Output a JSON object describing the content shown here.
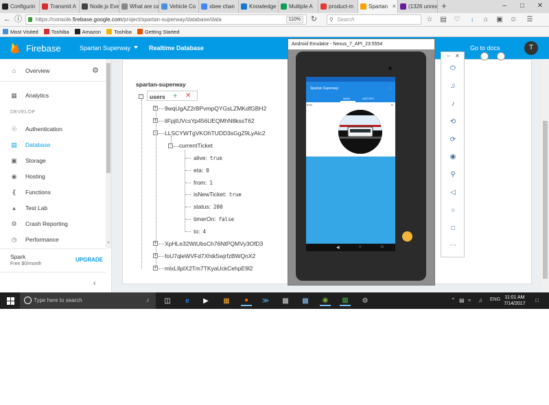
{
  "browser": {
    "tabs": [
      {
        "label": "Configurin",
        "color": "#222222"
      },
      {
        "label": "Transmit A",
        "color": "#d32f2f"
      },
      {
        "label": "Node.js Eve",
        "color": "#444444"
      },
      {
        "label": "What are callb",
        "color": "#888888"
      },
      {
        "label": "Vehicle Co",
        "color": "#4a90d9"
      },
      {
        "label": "xbee chan",
        "color": "#4285f4"
      },
      {
        "label": "Knowledge",
        "color": "#1976d2"
      },
      {
        "label": "Multiple A",
        "color": "#0f9d58"
      },
      {
        "label": "product-m",
        "color": "#e53935"
      },
      {
        "label": "Spartan",
        "color": "#ffa000"
      },
      {
        "label": "(1326 unrea",
        "color": "#6a1b9a"
      }
    ],
    "url_prefix": "https://console.",
    "url_domain": "firebase.google.com",
    "url_rest": "/project/spartan-superway/database/data",
    "zoom": "110%",
    "search_placeholder": "Search",
    "bookmarks": [
      {
        "label": "Most Visited",
        "color": "#4a90d9"
      },
      {
        "label": "Toshiba",
        "color": "#d32f2f"
      },
      {
        "label": "Amazon",
        "color": "#222222"
      },
      {
        "label": "Toshiba",
        "color": "#f4b400"
      },
      {
        "label": "Getting Started",
        "color": "#e65100"
      }
    ]
  },
  "firebase": {
    "brand": "Firebase",
    "project": "Spartan Superway",
    "section": "Realtime Database",
    "docs_link": "Go to docs",
    "avatar_initial": "T",
    "accent": "#039be5",
    "sidebar": {
      "overview": "Overview",
      "analytics": "Analytics",
      "develop_header": "DEVELOP",
      "items": [
        "Authentication",
        "Database",
        "Storage",
        "Hosting",
        "Functions",
        "Test Lab",
        "Crash Reporting",
        "Performance"
      ],
      "plan_name": "Spark",
      "plan_price": "Free $0/month",
      "upgrade": "UPGRADE"
    },
    "tree": {
      "root": "spartan-superway",
      "users": "users",
      "children_before": [
        "9wqUgAZ2rBPvmpQYGsLZMKdfGBH2",
        "liFpjtUVcsYp456UEQMhN8kssT62"
      ],
      "expanded_child": "LLSCYWTgVKOhTUDD3sGgZ9LyAlc2",
      "current_ticket": "currentTicket",
      "fields": [
        {
          "key": "alive:",
          "value": "true"
        },
        {
          "key": "eta:",
          "value": "0"
        },
        {
          "key": "from:",
          "value": "1"
        },
        {
          "key": "isNewTicket:",
          "value": "true"
        },
        {
          "key": "status:",
          "value": "200"
        },
        {
          "key": "timerOn:",
          "value": "false"
        },
        {
          "key": "to:",
          "value": "4"
        }
      ],
      "children_after": [
        "XpHLe32WtUbsCh76NtPQMVy3OfD3",
        "foU7qleWVFd7Xhtk5wjrfzBWQnX2",
        "mlxLIlpIX2Tm7TKyaUckCehpE9l2"
      ]
    }
  },
  "emulator": {
    "title": "Android Emulator - Nexus_7_API_23:5554",
    "app_title": "Spartan Superway",
    "tab_main": "MAIN",
    "tab_history": "HISTORY"
  },
  "taskbar": {
    "search_placeholder": "Type here to search",
    "lang": "ENG",
    "time": "11:01 AM",
    "date": "7/14/2017"
  }
}
